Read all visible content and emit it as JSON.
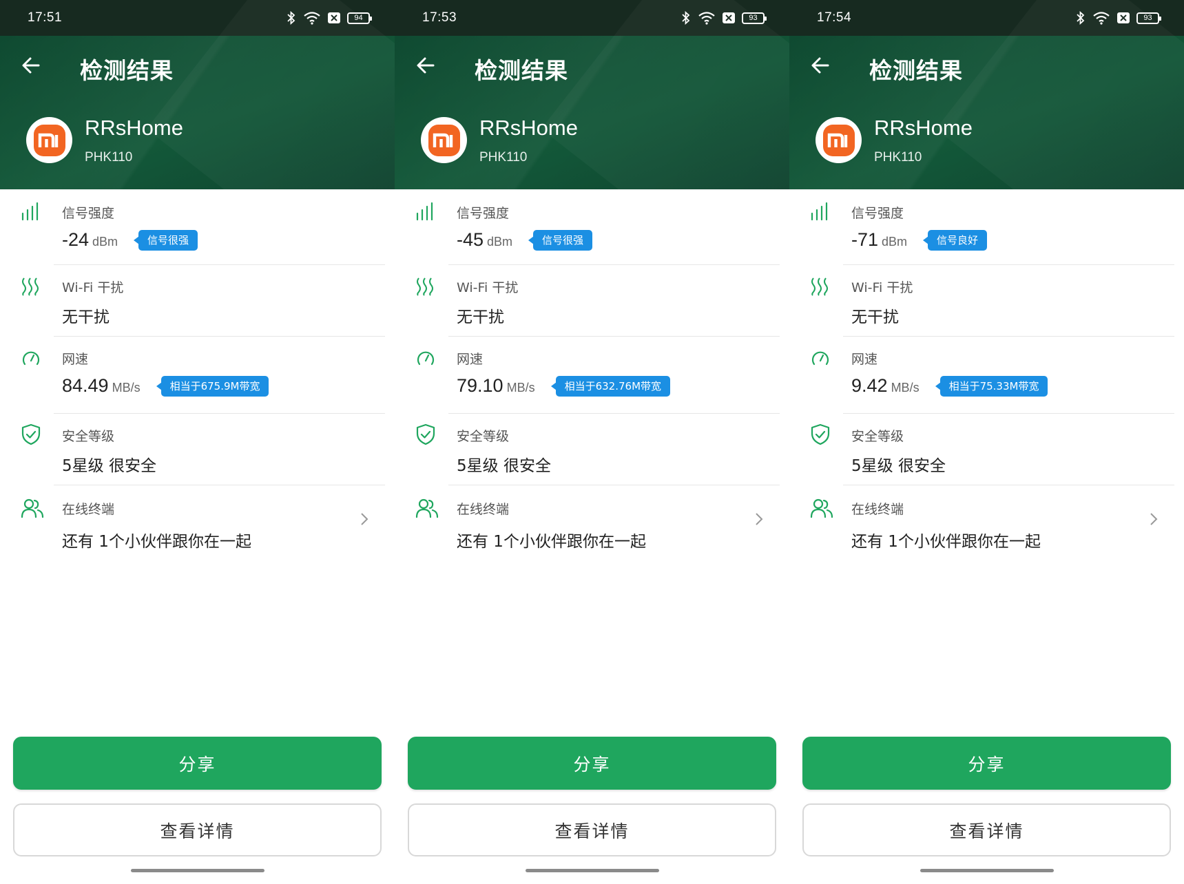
{
  "screens": [
    {
      "status": {
        "time": "17:51",
        "battery": "94"
      },
      "header": {
        "title": "检测结果",
        "device_name": "RRsHome",
        "device_model": "PHK110"
      },
      "signal": {
        "label": "信号强度",
        "value": "-24",
        "unit": "dBm",
        "badge": "信号很强"
      },
      "interference": {
        "label": "Wi-Fi 干扰",
        "value": "无干扰"
      },
      "speed": {
        "label": "网速",
        "value": "84.49",
        "unit": "MB/s",
        "badge": "相当于675.9M带宽"
      },
      "security": {
        "label": "安全等级",
        "value": "5星级 很安全"
      },
      "devices": {
        "label": "在线终端",
        "value": "还有 1个小伙伴跟你在一起"
      },
      "buttons": {
        "share": "分享",
        "details": "查看详情"
      }
    },
    {
      "status": {
        "time": "17:53",
        "battery": "93"
      },
      "header": {
        "title": "检测结果",
        "device_name": "RRsHome",
        "device_model": "PHK110"
      },
      "signal": {
        "label": "信号强度",
        "value": "-45",
        "unit": "dBm",
        "badge": "信号很强"
      },
      "interference": {
        "label": "Wi-Fi 干扰",
        "value": "无干扰"
      },
      "speed": {
        "label": "网速",
        "value": "79.10",
        "unit": "MB/s",
        "badge": "相当于632.76M带宽"
      },
      "security": {
        "label": "安全等级",
        "value": "5星级 很安全"
      },
      "devices": {
        "label": "在线终端",
        "value": "还有 1个小伙伴跟你在一起"
      },
      "buttons": {
        "share": "分享",
        "details": "查看详情"
      }
    },
    {
      "status": {
        "time": "17:54",
        "battery": "93"
      },
      "header": {
        "title": "检测结果",
        "device_name": "RRsHome",
        "device_model": "PHK110"
      },
      "signal": {
        "label": "信号强度",
        "value": "-71",
        "unit": "dBm",
        "badge": "信号良好"
      },
      "interference": {
        "label": "Wi-Fi 干扰",
        "value": "无干扰"
      },
      "speed": {
        "label": "网速",
        "value": "9.42",
        "unit": "MB/s",
        "badge": "相当于75.33M带宽"
      },
      "security": {
        "label": "安全等级",
        "value": "5星级 很安全"
      },
      "devices": {
        "label": "在线终端",
        "value": "还有 1个小伙伴跟你在一起"
      },
      "buttons": {
        "share": "分享",
        "details": "查看详情"
      }
    }
  ],
  "icons": {
    "back": "arrow-left-icon",
    "signal": "signal-bars-icon",
    "interference": "wave-interference-icon",
    "speed": "speedometer-icon",
    "security": "shield-check-icon",
    "devices": "users-icon",
    "chevron": "chevron-right-icon",
    "brand": "mi-logo-icon"
  },
  "colors": {
    "header_green": "#135839",
    "accent_green": "#1fa65e",
    "badge_blue": "#1b8fe3",
    "brand_orange": "#f26522"
  }
}
